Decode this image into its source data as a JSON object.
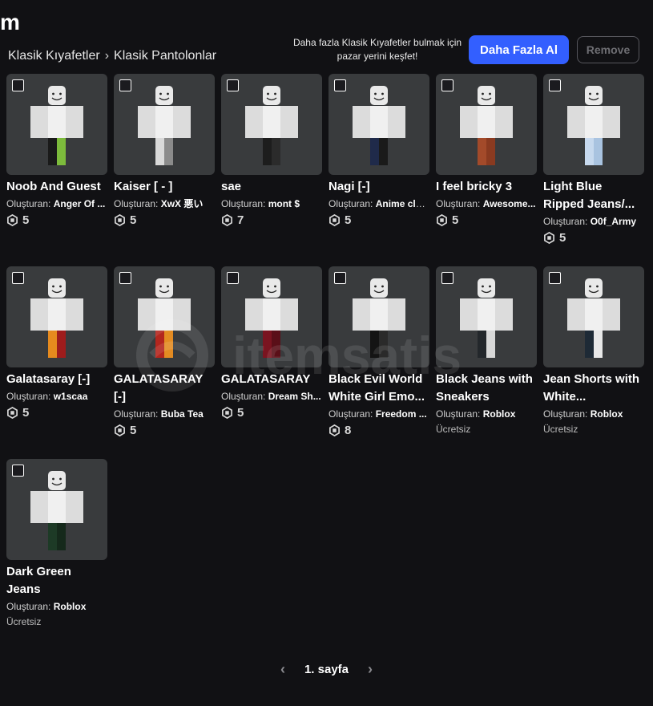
{
  "header": {
    "title_fragment": "m",
    "breadcrumb": [
      "Klasik Kıyafetler",
      "Klasik Pantolonlar"
    ],
    "prompt": "Daha fazla Klasik Kıyafetler bulmak için pazar yerini keşfet!",
    "primary_button": "Daha Fazla Al",
    "remove_button": "Remove"
  },
  "creator_label": "Oluşturan:",
  "colors": {
    "accent": "#335fff",
    "card_bg": "#393b3d",
    "page_bg": "#111114"
  },
  "items": [
    {
      "name": "Noob And Guest",
      "creator": "Anger Of ...",
      "price": "5",
      "pants": [
        "#1a1a1a",
        "#7dbb3c"
      ]
    },
    {
      "name": "Kaiser [ - ]",
      "creator": "XwX 悪い",
      "price": "5",
      "pants": [
        "#d9d9d9",
        "#8b8b8b"
      ]
    },
    {
      "name": "sae",
      "creator": "mont $",
      "price": "7",
      "pants": [
        "#1d1d1d",
        "#2b2b2b"
      ]
    },
    {
      "name": "Nagi [-]",
      "creator": "Anime clo...",
      "price": "5",
      "pants": [
        "#1f2a4a",
        "#1a1a1a"
      ]
    },
    {
      "name": "I feel bricky 3",
      "creator": "Awesome...",
      "price": "5",
      "pants": [
        "#a34a2a",
        "#8a3a20"
      ]
    },
    {
      "name": "Light Blue Ripped Jeans/...",
      "creator": "O0f_Army",
      "price": "5",
      "pants": [
        "#c7d9ee",
        "#a9c3e0"
      ]
    },
    {
      "name": "Galatasaray [-]",
      "creator": "w1scaa",
      "price": "5",
      "pants": [
        "#e68a1e",
        "#9e1c1c"
      ]
    },
    {
      "name": "GALATASARAY [-]",
      "creator": "Buba Tea",
      "price": "5",
      "pants": [
        "#b3261e",
        "#e38b22"
      ]
    },
    {
      "name": "GALATASARAY",
      "creator": "Dream Sh...",
      "price": "5",
      "pants": [
        "#7a1420",
        "#5a0f18"
      ]
    },
    {
      "name": "Black Evil World White Girl Emo...",
      "creator": "Freedom ...",
      "price": "8",
      "pants": [
        "#141414",
        "#2a2a2a"
      ]
    },
    {
      "name": "Black Jeans with Sneakers",
      "creator": "Roblox",
      "price": "Ücretsiz",
      "pants": [
        "#23272b",
        "#d8d8d8"
      ]
    },
    {
      "name": "Jean Shorts with White...",
      "creator": "Roblox",
      "price": "Ücretsiz",
      "pants": [
        "#1e2a36",
        "#e8e8e8"
      ]
    },
    {
      "name": "Dark Green Jeans",
      "creator": "Roblox",
      "price": "Ücretsiz",
      "pants": [
        "#1d3a26",
        "#15291b"
      ]
    }
  ],
  "pager": {
    "label": "1. sayfa"
  },
  "watermark": "itemsatis"
}
